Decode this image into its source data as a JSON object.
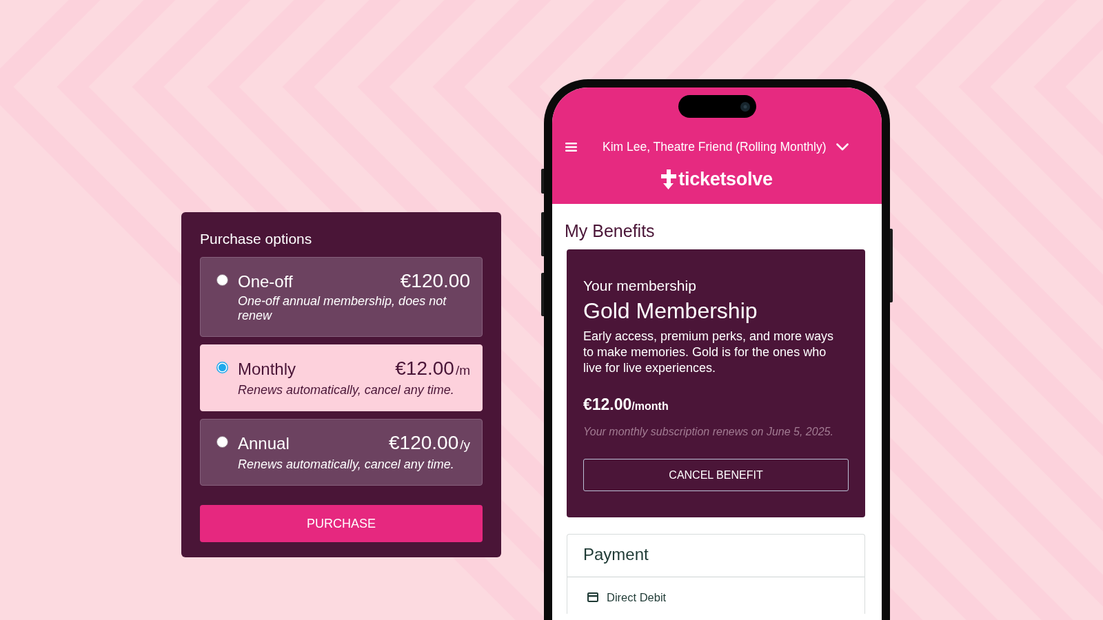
{
  "purchase_panel": {
    "title": "Purchase options",
    "options": [
      {
        "label": "One-off",
        "price": "€120.00",
        "description": "One-off annual membership, does not renew",
        "selected": false
      },
      {
        "label": "Monthly",
        "price": "€12.00",
        "period": "/m",
        "description": "Renews automatically, cancel any time.",
        "selected": true
      },
      {
        "label": "Annual",
        "price": "€120.00",
        "period": "/y",
        "description": "Renews automatically, cancel any time.",
        "selected": false
      }
    ],
    "button": "PURCHASE"
  },
  "phone": {
    "header": {
      "account": "Kim Lee, Theatre Friend (Rolling Monthly)",
      "logo": "ticketsolve"
    },
    "page_title": "My Benefits",
    "membership_card": {
      "eyebrow": "Your membership",
      "name": "Gold Membership",
      "description": "Early access, premium perks, and more ways to make memories. Gold is for the ones who live for live experiences.",
      "price": "€12.00",
      "period": "/month",
      "renewal_note": "Your monthly subscription renews on June 5, 2025.",
      "button": "CANCEL BENEFIT"
    },
    "payment": {
      "title": "Payment",
      "method": "Direct Debit"
    }
  }
}
